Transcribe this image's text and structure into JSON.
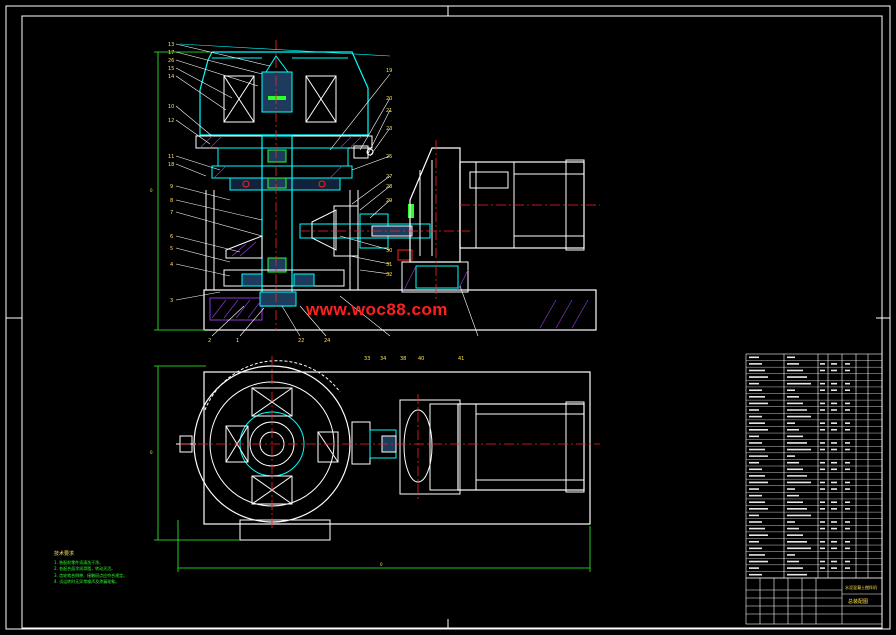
{
  "watermark": "www.woc88.com",
  "colors": {
    "background": "#000000",
    "frame": "#ffffff",
    "outline": "#ffffff",
    "section": "#00ffff",
    "dimension": "#2dff2d",
    "centerline": "#ff2020",
    "leader": "#ff2020",
    "hatch": "#8a3ad6",
    "text": "#ffe14a"
  },
  "notes": {
    "heading": "技术要求",
    "items": [
      "1. 装配前零件须清洗干净。",
      "2. 各配合面涂润滑脂，转动灵活。",
      "3. 齿轮啮合侧隙、接触斑点应符合规定。",
      "4. 试运转时无异常噪声及渗漏现象。"
    ]
  },
  "title_block": {
    "title": "总装配图",
    "subtitle": "水泥混凝土搅拌机"
  },
  "balloons_top": [
    "13",
    "17",
    "26",
    "15",
    "14",
    "10",
    "12",
    "11",
    "18",
    "9",
    "8",
    "7",
    "6",
    "5",
    "4",
    "3"
  ],
  "balloons_bottom": [
    "2",
    "1",
    "22",
    "24"
  ],
  "balloons_right": [
    "19",
    "20",
    "21",
    "23",
    "25",
    "27",
    "28",
    "29",
    "30",
    "31",
    "32"
  ],
  "balloons_plan": [
    "33",
    "34",
    "38",
    "40",
    "41"
  ]
}
